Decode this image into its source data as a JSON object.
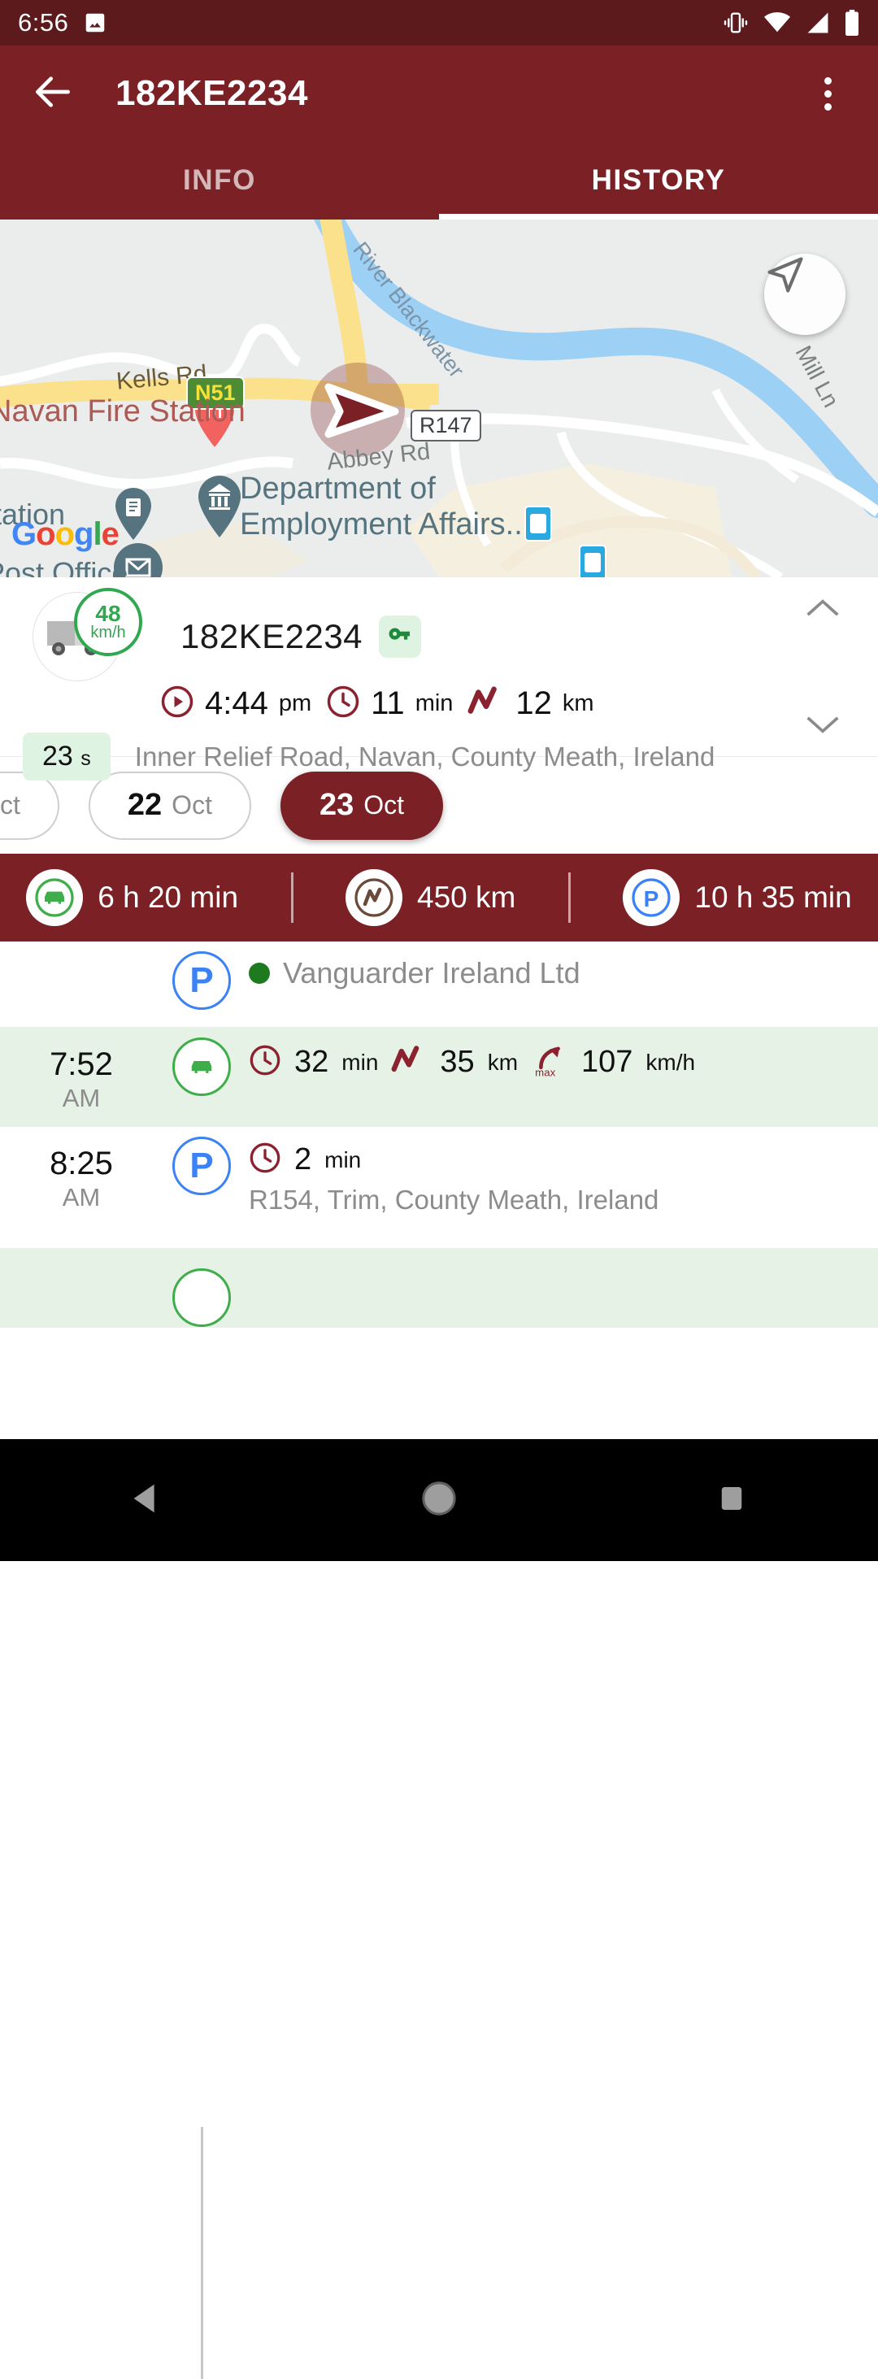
{
  "status_bar": {
    "time": "6:56",
    "icons": [
      "image-icon",
      "vibrate-icon",
      "wifi-icon",
      "cellular-signal-icon",
      "battery-icon"
    ]
  },
  "app_bar": {
    "back_icon": "arrow-back-icon",
    "title": "182KE2234",
    "overflow_icon": "more-vert-icon",
    "tabs": [
      {
        "label": "INFO",
        "active": false
      },
      {
        "label": "HISTORY",
        "active": true
      }
    ]
  },
  "map": {
    "gps_icon": "navigation-arrow-icon",
    "attribution": "Google",
    "labels": {
      "river": "River Blackwater",
      "kells_rd": "Kells Rd",
      "n51_shield": "N51",
      "fire_station": "Navan Fire Station",
      "abbey_rd": "Abbey Rd",
      "r147_shield": "R147",
      "mill_ln": "Mill Ln",
      "dept_line1": "Department of",
      "dept_line2": "Employment Affairs...",
      "station_partial": "tation",
      "post_office_partial": "Post Office"
    }
  },
  "vehicle_card": {
    "avatar_icon": "truck-icon",
    "speed_value": "48",
    "speed_unit": "km/h",
    "plate": "182KE2234",
    "ignition_icon": "key-icon",
    "metrics": [
      {
        "icon": "play-circle-icon",
        "value": "4:44",
        "unit": "pm"
      },
      {
        "icon": "clock-icon",
        "value": "11",
        "unit": "min"
      },
      {
        "icon": "route-icon",
        "value": "12",
        "unit": "km"
      }
    ],
    "duration_value": "23",
    "duration_unit": "s",
    "address": "Inner Relief Road, Navan, County Meath, Ireland",
    "collapse_icon": "chevron-up-icon",
    "expand_icon": "chevron-down-icon"
  },
  "date_chips": [
    {
      "day": "",
      "month": "ct",
      "selected": false
    },
    {
      "day": "22",
      "month": "Oct",
      "selected": false
    },
    {
      "day": "23",
      "month": "Oct",
      "selected": true
    }
  ],
  "summary_bar": [
    {
      "icon": "car-icon",
      "value": "6",
      "unit1": "h",
      "value2": "20",
      "unit2": "min",
      "text": "6 h 20 min"
    },
    {
      "icon": "route-icon",
      "value": "450",
      "unit1": "km",
      "text": "450 km"
    },
    {
      "icon": "parking-icon",
      "value": "10",
      "unit1": "h",
      "value2": "35",
      "unit2": "min",
      "text": "10 h 35 min"
    }
  ],
  "timeline": [
    {
      "type": "park",
      "time": "",
      "ampm": "",
      "badge": "P",
      "badge_color": "#3b82f6",
      "company": "Vanguarder Ireland Ltd",
      "metrics": [],
      "address": ""
    },
    {
      "type": "drive",
      "time": "7:52",
      "ampm": "AM",
      "badge": "car-icon",
      "badge_color": "#3fae4a",
      "metrics": [
        {
          "icon": "clock-icon",
          "value": "32",
          "unit": "min"
        },
        {
          "icon": "route-icon",
          "value": "35",
          "unit": "km"
        },
        {
          "icon": "max-speed-icon",
          "value": "107",
          "unit": "km/h"
        }
      ],
      "address": ""
    },
    {
      "type": "park",
      "time": "8:25",
      "ampm": "AM",
      "badge": "P",
      "badge_color": "#3b82f6",
      "metrics": [
        {
          "icon": "clock-icon",
          "value": "2",
          "unit": "min"
        }
      ],
      "address": "R154, Trim, County Meath, Ireland"
    }
  ],
  "nav_bar": {
    "back": "nav-back-icon",
    "home": "nav-home-icon",
    "recents": "nav-recents-icon"
  },
  "colors": {
    "status_bar": "#5c1a1c",
    "app_bar": "#7b2126",
    "accent": "#7b2126",
    "green": "#3fae4a",
    "blue": "#3b82f6",
    "drive_row": "#e6f2e6"
  }
}
